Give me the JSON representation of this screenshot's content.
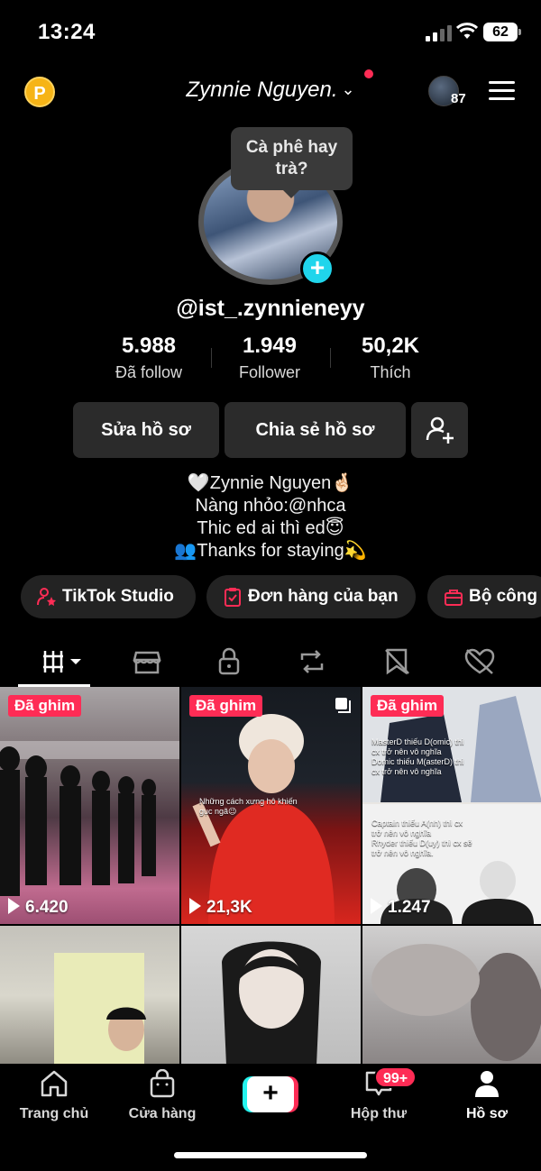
{
  "status_bar": {
    "time": "13:24",
    "battery": "62"
  },
  "header": {
    "display_name": "Zynnie Nguyen.",
    "coin_label": "P",
    "friends_count": "87"
  },
  "profile": {
    "bubble_note": "Cà phê hay trà?",
    "handle": "@ist_.zynnieneyy",
    "stats": [
      {
        "value": "5.988",
        "label": "Đã follow"
      },
      {
        "value": "1.949",
        "label": "Follower"
      },
      {
        "value": "50,2K",
        "label": "Thích"
      }
    ],
    "buttons": {
      "edit": "Sửa hồ sơ",
      "share": "Chia sẻ hồ sơ"
    },
    "bio": [
      "🤍Zynnie Nguyen🤞🏻",
      "Nàng nhỏo:@nhca",
      "Thic ed ai thì ed😇",
      "👥Thanks for staying💫"
    ]
  },
  "chips": {
    "studio": "TikTok Studio",
    "orders": "Đơn hàng của bạn",
    "tools": "Bộ công"
  },
  "videos": [
    {
      "pinned": "Đã ghim",
      "views": "6.420"
    },
    {
      "pinned": "Đã ghim",
      "views": "21,3K",
      "caption": "Những cách xưng hô khiến\ngục ngã😉"
    },
    {
      "pinned": "Đã ghim",
      "views": "1.247",
      "caption_top": "MasterD thiếu D(omic) thì\ncx trở nên vô nghĩa\nDomic thiếu M(asterD) thì\ncx trở nên vô nghĩa",
      "caption_bottom": "Captain thiếu A(nh) thì cx\ntrở nên vô nghĩa\nRhyder thiếu D(uy) thì cx sẽ\ntrở nên vô nghĩa."
    },
    {},
    {},
    {}
  ],
  "bottom_nav": {
    "home": "Trang chủ",
    "shop": "Cửa hàng",
    "inbox": "Hộp thư",
    "inbox_badge": "99+",
    "profile": "Hồ sơ"
  },
  "colors": {
    "accent_red": "#fe2c55",
    "accent_cyan": "#25f4ee",
    "coin": "#f6b417"
  }
}
